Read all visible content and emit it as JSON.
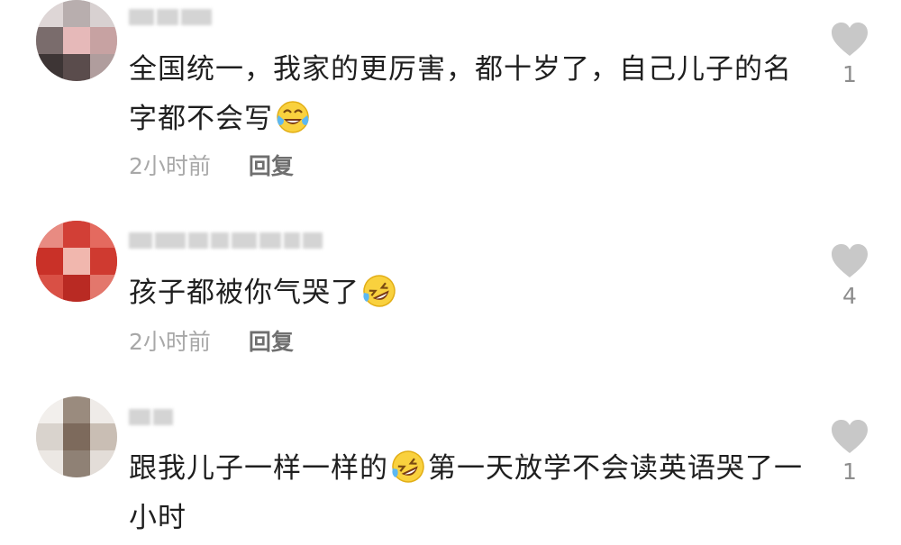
{
  "comments": [
    {
      "text": "全国统一，我家的更厉害，都十岁了，自己儿子的名字都不会写",
      "emoji": "crying-laughing-emoji",
      "time": "2小时前",
      "reply": "回复",
      "likes": "1"
    },
    {
      "text": "孩子都被你气哭了",
      "emoji": "rofl-emoji",
      "time": "2小时前",
      "reply": "回复",
      "likes": "4"
    },
    {
      "text_before": "跟我儿子一样一样的",
      "text_after": "第一天放学不会读英语哭了一小时",
      "emoji": "rofl-emoji",
      "likes": "1"
    }
  ],
  "icons": {
    "like": "heart-icon"
  },
  "colors": {
    "heart": "#c8c8c8",
    "time": "#a8a8a8",
    "reply": "#6f6f6f",
    "text": "#1f1f1f"
  }
}
